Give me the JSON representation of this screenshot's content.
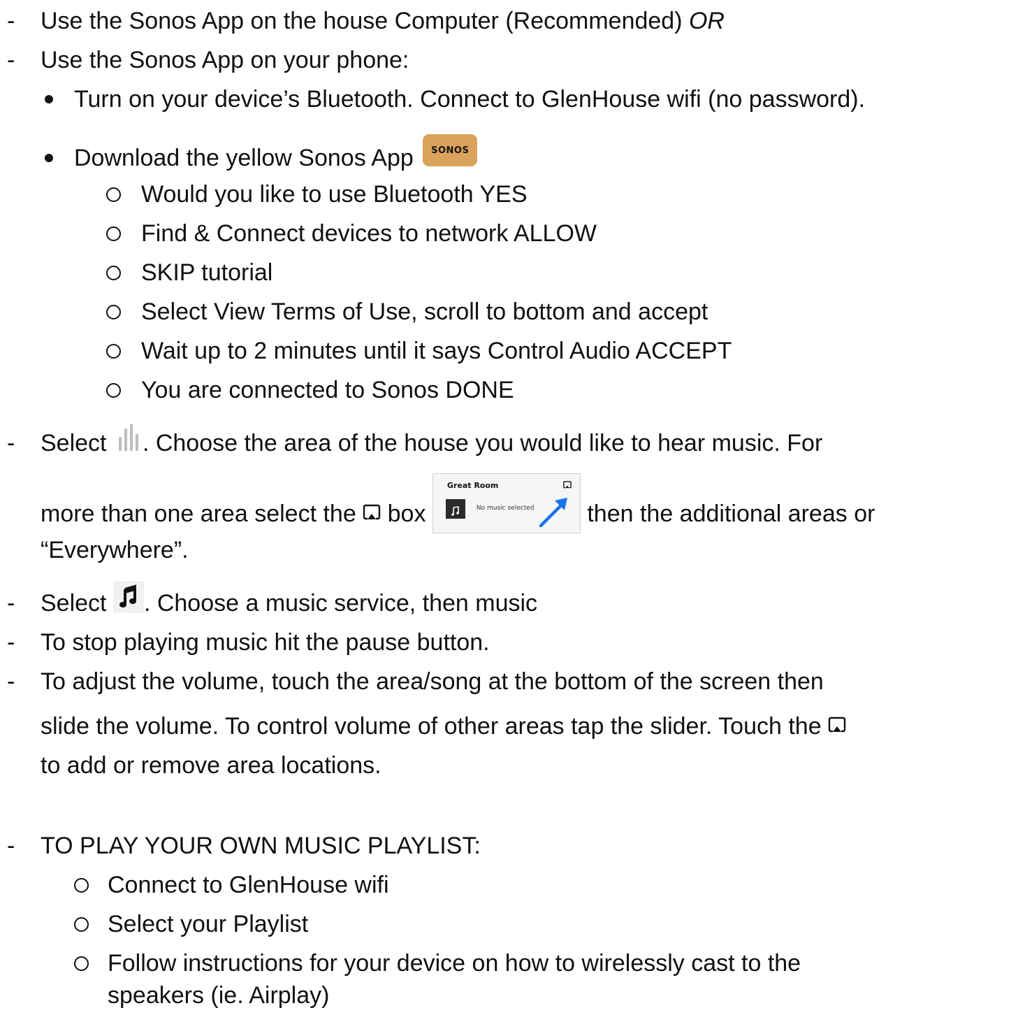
{
  "items": {
    "l1a": "Use the Sonos App on the house Computer (Recommended) ",
    "l1b": "OR",
    "l2": "Use the Sonos App on your phone:",
    "b1": "Turn on your device’s Bluetooth. Connect to GlenHouse wifi (no password).",
    "b2": "Download the yellow Sonos App",
    "o1": "Would you like to use Bluetooth YES",
    "o2": "Find & Connect devices to network ALLOW",
    "o3": "SKIP tutorial",
    "o4": "Select View Terms of Use, scroll to bottom and accept",
    "o5": "Wait up to 2 minutes until it says Control Audio ACCEPT",
    "o6": "You are connected to Sonos DONE",
    "s1a": "Select ",
    "s1b": ". Choose the area of the house you would like to hear music. For",
    "s2a": "more than one area select the ",
    "s2b": " box ",
    "s2c": " then the additional areas or",
    "s3": "“Everywhere”.",
    "m1a": "Select ",
    "m1b": ". Choose a music service, then music",
    "p1": "To stop playing music hit the pause button.",
    "v1": "To adjust the volume, touch the area/song at the bottom of the screen then",
    "v2a": "slide the volume.  To control volume of other areas tap the slider. Touch the ",
    "v3": "to add or remove area locations.",
    "h1": "TO PLAY YOUR OWN MUSIC PLAYLIST:",
    "q1": "Connect to GlenHouse wifi",
    "q2": "Select your Playlist",
    "q3": "Follow instructions for your device on how to wirelessly cast to the",
    "q4": "speakers (ie. Airplay)",
    "dash": "-"
  },
  "sonos_badge": "SONOS",
  "great_room": {
    "title": "Great Room",
    "status": "No music selected"
  },
  "colors": {
    "sonos_badge": "#d9a35b",
    "arrow": "#1a73e8"
  },
  "icons": [
    "sonos-app-icon",
    "rooms-bars-icon",
    "group-airplay-icon",
    "music-note-icon",
    "arrow-icon"
  ]
}
